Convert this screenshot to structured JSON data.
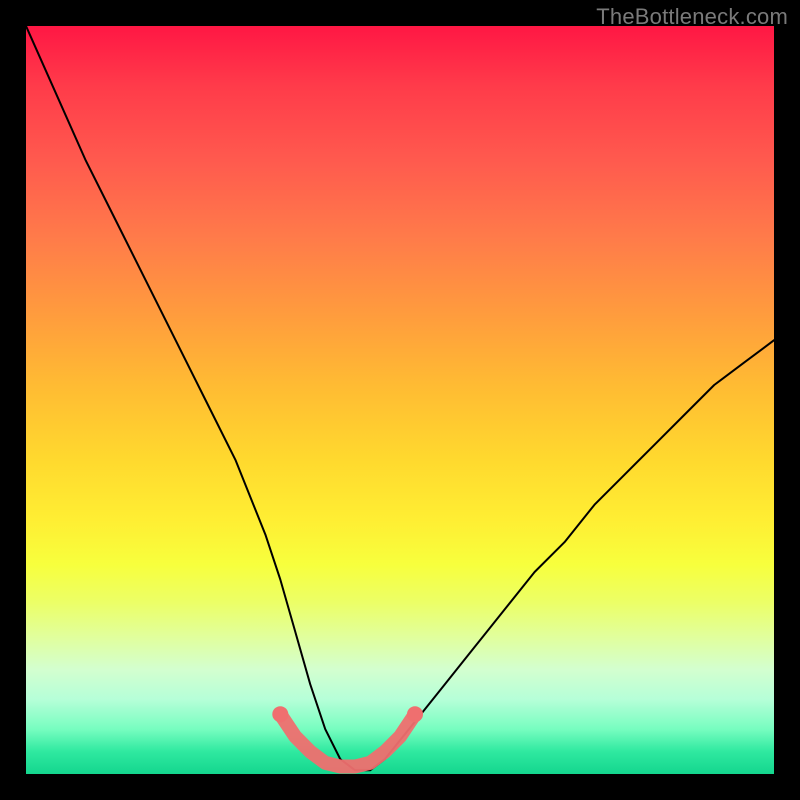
{
  "watermark": "TheBottleneck.com",
  "colors": {
    "frame": "#000000",
    "curve": "#000000",
    "highlight": "#ef6f6f",
    "gradient_top": "#ff1744",
    "gradient_mid": "#ffee33",
    "gradient_bottom": "#14d68e"
  },
  "chart_data": {
    "type": "line",
    "title": "",
    "xlabel": "",
    "ylabel": "",
    "xlim": [
      0,
      100
    ],
    "ylim": [
      0,
      100
    ],
    "grid": false,
    "legend": false,
    "series": [
      {
        "name": "curve",
        "x": [
          0,
          4,
          8,
          12,
          16,
          20,
          24,
          28,
          32,
          34,
          36,
          38,
          40,
          42,
          44,
          46,
          48,
          52,
          56,
          60,
          64,
          68,
          72,
          76,
          80,
          84,
          88,
          92,
          96,
          100
        ],
        "y": [
          100,
          91,
          82,
          74,
          66,
          58,
          50,
          42,
          32,
          26,
          19,
          12,
          6,
          2,
          0.5,
          0.5,
          2,
          7,
          12,
          17,
          22,
          27,
          31,
          36,
          40,
          44,
          48,
          52,
          55,
          58
        ]
      },
      {
        "name": "highlight",
        "x": [
          34,
          36,
          38,
          40,
          42,
          44,
          46,
          48,
          50,
          52
        ],
        "y": [
          8,
          5,
          3,
          1.5,
          1,
          1,
          1.5,
          3,
          5,
          8
        ]
      }
    ],
    "annotations": []
  }
}
